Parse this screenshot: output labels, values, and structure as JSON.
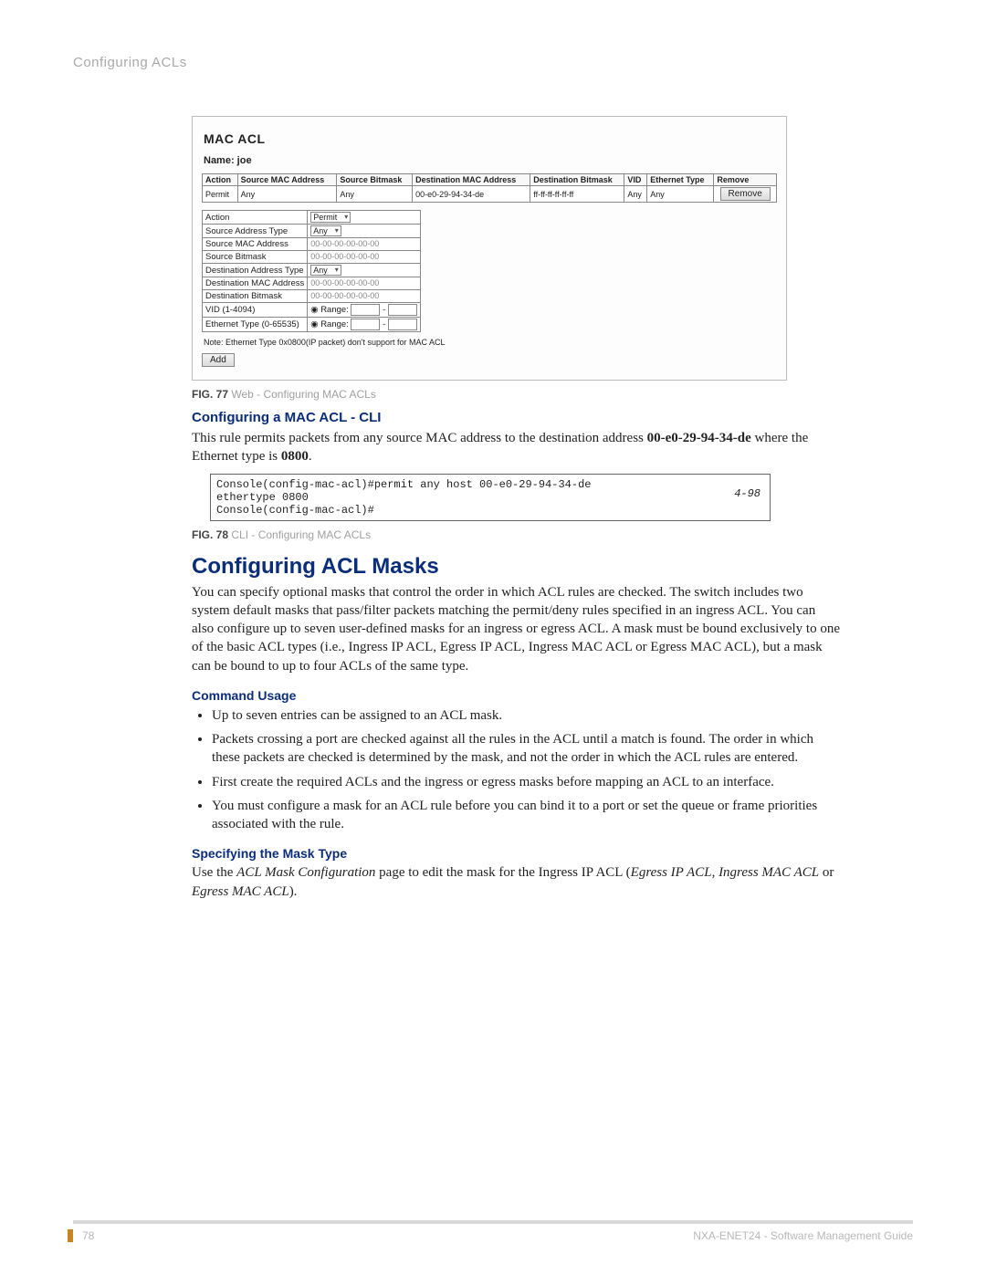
{
  "header": {
    "breadcrumb": "Configuring ACLs"
  },
  "mac_acl_panel": {
    "title": "MAC ACL",
    "name_label": "Name: joe",
    "table_headers": [
      "Action",
      "Source MAC Address",
      "Source Bitmask",
      "Destination MAC Address",
      "Destination Bitmask",
      "VID",
      "Ethernet Type",
      "Remove"
    ],
    "table_row": {
      "action": "Permit",
      "src_mac": "Any",
      "src_bitmask": "Any",
      "dst_mac": "00-e0-29-94-34-de",
      "dst_bitmask": "ff-ff-ff-ff-ff-ff",
      "vid": "Any",
      "eth": "Any",
      "remove": "Remove"
    },
    "form": {
      "action": {
        "label": "Action",
        "value": "Permit"
      },
      "src_type": {
        "label": "Source Address Type",
        "value": "Any"
      },
      "src_mac": {
        "label": "Source MAC Address",
        "value": "00-00-00-00-00-00"
      },
      "src_bitmask": {
        "label": "Source Bitmask",
        "value": "00-00-00-00-00-00"
      },
      "dst_type": {
        "label": "Destination Address Type",
        "value": "Any"
      },
      "dst_mac": {
        "label": "Destination MAC Address",
        "value": "00-00-00-00-00-00"
      },
      "dst_bitmask": {
        "label": "Destination Bitmask",
        "value": "00-00-00-00-00-00"
      },
      "vid": {
        "label": "VID (1-4094)",
        "radio": "Range:",
        "dash": "-"
      },
      "eth": {
        "label": "Ethernet Type (0-65535)",
        "radio": "Range:",
        "dash": "-"
      }
    },
    "note": "Note: Ethernet Type 0x0800(IP packet) don't support for MAC ACL",
    "add": "Add"
  },
  "fig77": {
    "b": "FIG. 77",
    "text": "  Web - Configuring MAC ACLs"
  },
  "sec_cli_heading": "Configuring a MAC ACL - CLI",
  "cli_intro_pre": "This rule permits packets from any source MAC address to the destination address ",
  "cli_intro_bold": "00-e0-29-94-34-de",
  "cli_intro_mid": " where the Ethernet type is ",
  "cli_intro_bold2": "0800",
  "cli_intro_post": ".",
  "cli_box": {
    "line1": "Console(config-mac-acl)#permit any host 00-e0-29-94-34-de",
    "line2": "  ethertype 0800",
    "line3": "Console(config-mac-acl)#",
    "ref": "4-98"
  },
  "fig78": {
    "b": "FIG. 78",
    "text": "  CLI - Configuring MAC ACLs"
  },
  "sec_mask_heading": "Configuring ACL Masks",
  "mask_intro": "You can specify optional masks that control the order in which ACL rules are checked. The switch includes two system default masks that pass/filter packets matching the permit/deny rules specified in an ingress ACL. You can also configure up to seven user-defined masks for an ingress or egress ACL. A mask must be bound exclusively to one of the basic ACL types (i.e., Ingress IP ACL, Egress IP ACL, Ingress MAC ACL or Egress MAC ACL), but a mask can be bound to up to four ACLs of the same type.",
  "cmd_usage_heading": "Command Usage",
  "bullets": [
    "Up to seven entries can be assigned to an ACL mask.",
    "Packets crossing a port are checked against all the rules in the ACL until a match is found. The order in which these packets are checked is determined by the mask, and not the order in which the ACL rules are entered.",
    "First create the required ACLs and the ingress or egress masks before mapping an ACL to an interface.",
    "You must configure a mask for an ACL rule before you can bind it to a port or set the queue or frame priorities associated with the rule."
  ],
  "spec_mask_heading": "Specifying the Mask Type",
  "spec_mask_body_pre": "Use the ",
  "spec_mask_body_i1": "ACL Mask Configuration",
  "spec_mask_body_mid": " page to edit the mask for the Ingress IP ACL (",
  "spec_mask_body_i2": "Egress IP ACL",
  "spec_mask_body_c1": ", ",
  "spec_mask_body_i3": "Ingress MAC ACL",
  "spec_mask_body_c2": " or ",
  "spec_mask_body_i4": "Egress MAC ACL",
  "spec_mask_body_post": ").",
  "footer": {
    "page": "78",
    "doc": "NXA-ENET24 - Software Management Guide"
  }
}
